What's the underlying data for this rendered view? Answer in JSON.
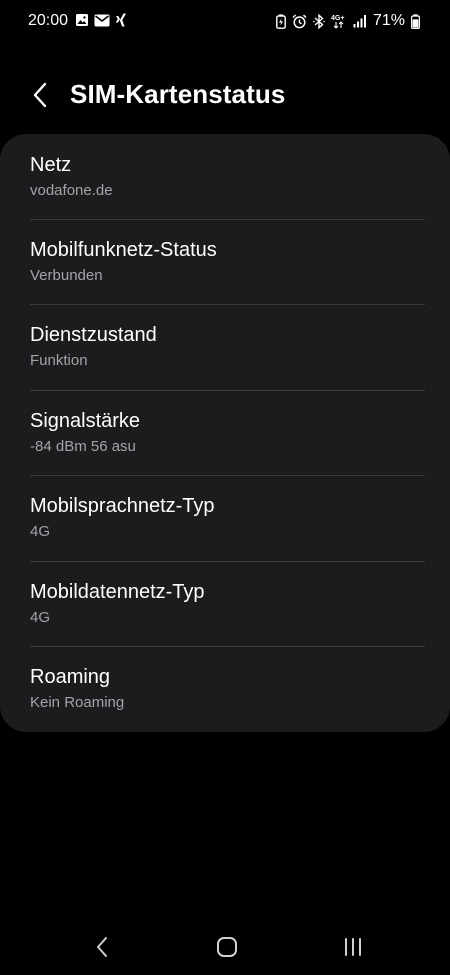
{
  "status_bar": {
    "time": "20:00",
    "battery_percent": "71%",
    "network_badge": "4G+",
    "left_icons": [
      "image-icon",
      "mail-icon",
      "xing-icon"
    ],
    "right_icons": [
      "battery-saver-icon",
      "alarm-icon",
      "bluetooth-icon",
      "network-4g-icon",
      "signal-icon",
      "battery-icon"
    ]
  },
  "header": {
    "back_icon": "chevron-left-icon",
    "title": "SIM-Kartenstatus"
  },
  "items": [
    {
      "label": "Netz",
      "value": "vodafone.de"
    },
    {
      "label": "Mobilfunknetz-Status",
      "value": "Verbunden"
    },
    {
      "label": "Dienstzustand",
      "value": "Funktion"
    },
    {
      "label": "Signalstärke",
      "value": "-84 dBm 56 asu"
    },
    {
      "label": "Mobilsprachnetz-Typ",
      "value": "4G"
    },
    {
      "label": "Mobildatennetz-Typ",
      "value": "4G"
    },
    {
      "label": "Roaming",
      "value": "Kein Roaming"
    }
  ],
  "nav_bar": {
    "buttons": [
      "back-nav-icon",
      "home-icon",
      "recents-icon"
    ]
  },
  "colors": {
    "background": "#000000",
    "card": "#1c1c1e",
    "text_primary": "#ffffff",
    "text_secondary": "#a3a3a8",
    "divider": "#3a3a3c"
  }
}
